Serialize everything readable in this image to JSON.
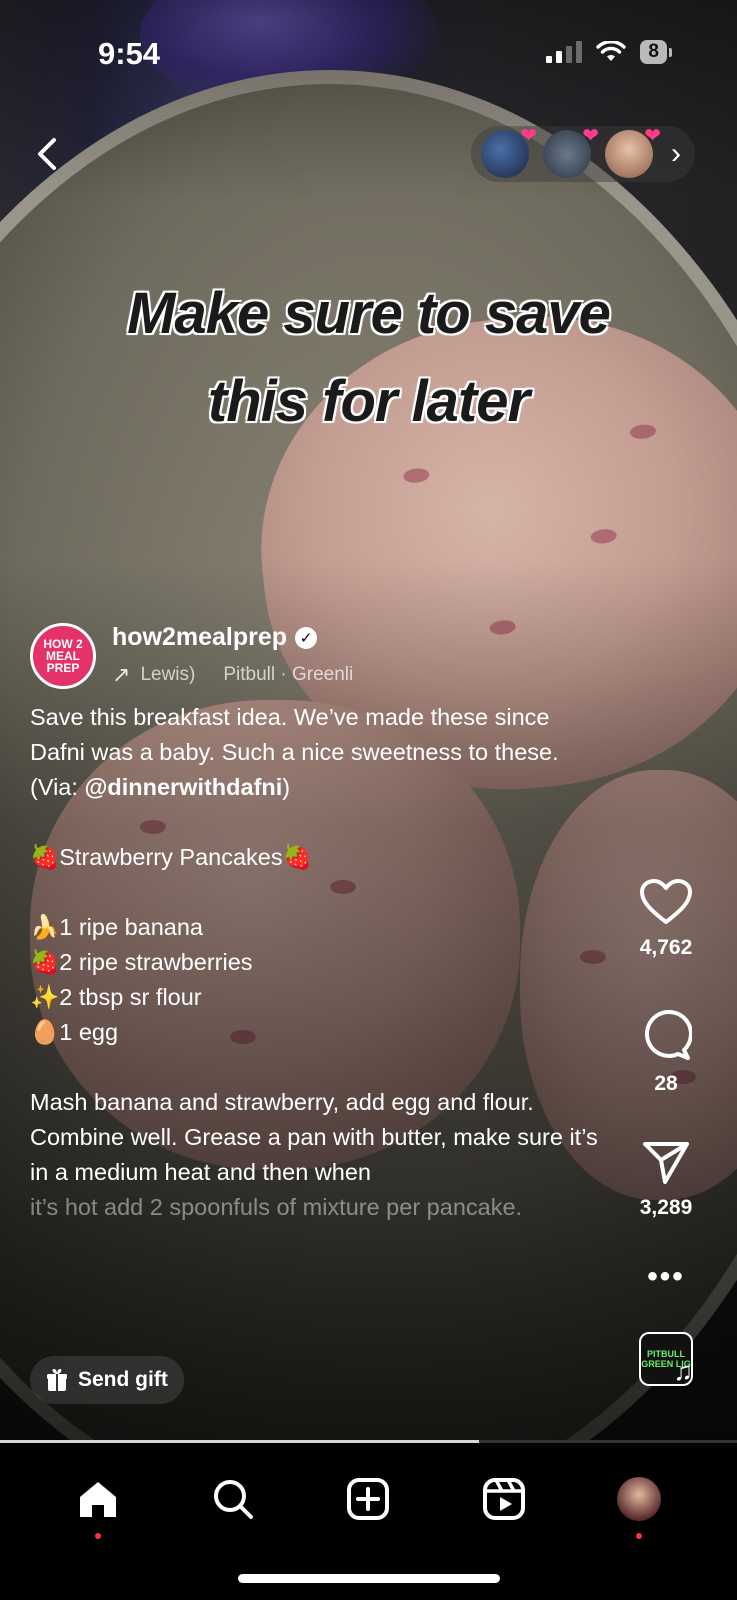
{
  "status_bar": {
    "time": "9:54",
    "battery": "8"
  },
  "post": {
    "overlay_text_line1": "Make sure to save",
    "overlay_text_line2": "this for later",
    "author": "how2mealprep",
    "avatar_text": "HOW 2 MEAL PREP",
    "audio_prefix": "Lewis)",
    "audio_track": "Pitbull · Greenli",
    "caption": {
      "line1": "Save this breakfast idea. We’ve made these since Dafni was a baby. Such a nice sweetness to these.",
      "via_prefix": "(Via: ",
      "via_handle": "@dinnerwithdafni",
      "via_suffix": ")",
      "title": "🍓Strawberry Pancakes🍓",
      "ingredients": [
        "🍌1 ripe banana",
        "🍓2 ripe strawberries",
        "✨2 tbsp sr flour",
        "🥚1 egg"
      ],
      "method": "Mash banana and strawberry, add egg and flour. Combine well. Grease a pan with butter, make sure it’s in a medium heat and then when",
      "method_faded": "it’s hot add 2 spoonfuls of mixture per pancake."
    },
    "likes": "4,762",
    "comments": "28",
    "shares": "3,289",
    "more": "•••",
    "music_thumb_text": "PITBULL GREEN LIG",
    "send_gift_label": "Send gift",
    "video_progress": 0.65
  },
  "icons": {
    "back": "chevron-left-icon",
    "viewers_next": "chevron-right-icon",
    "like": "heart-icon",
    "comment": "comment-icon",
    "share": "send-icon",
    "gift": "gift-icon",
    "home": "home-icon",
    "search": "search-icon",
    "create": "plus-square-icon",
    "reels": "reels-icon"
  },
  "colors": {
    "notification_dot": "#ff3040",
    "brand_avatar": "#e4336b",
    "viewer_heart": "#ff3b8a"
  }
}
